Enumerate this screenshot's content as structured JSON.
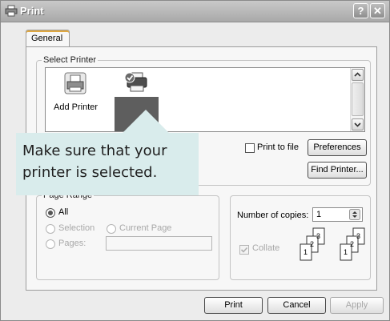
{
  "window": {
    "title": "Print"
  },
  "titlebar": {
    "help_label": "?",
    "close_label": "✕"
  },
  "tabs": [
    {
      "label": "General"
    }
  ],
  "select_printer": {
    "legend": "Select Printer",
    "items": [
      {
        "label": "Add Printer",
        "icon": "add-printer-icon"
      },
      {
        "label": "",
        "icon": "printer-icon",
        "selected": true
      }
    ],
    "print_to_file_label": "Print to file",
    "preferences_label": "Preferences",
    "find_printer_label": "Find Printer..."
  },
  "callout": {
    "text": "Make sure that your printer is selected."
  },
  "page_range": {
    "legend": "Page Range",
    "all_label": "All",
    "selection_label": "Selection",
    "current_page_label": "Current Page",
    "pages_label": "Pages:",
    "pages_value": ""
  },
  "copies": {
    "number_label": "Number of copies:",
    "number_value": "1",
    "collate_label": "Collate",
    "collate_checked": true
  },
  "buttons": {
    "print_label": "Print",
    "cancel_label": "Cancel",
    "apply_label": "Apply"
  },
  "colors": {
    "callout_bg": "#d9ecec",
    "selected_item_bg": "#5e5e5e"
  }
}
